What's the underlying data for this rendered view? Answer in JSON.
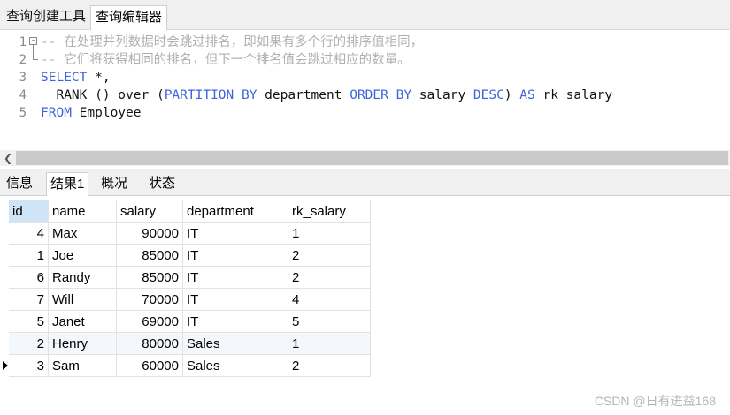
{
  "top_tabs": [
    "查询创建工具",
    "查询编辑器"
  ],
  "editor": {
    "line_numbers": [
      "1",
      "2",
      "3",
      "4",
      "5"
    ],
    "lines": [
      [
        {
          "t": "cm",
          "v": "-- 在处理并列数据时会跳过排名，即如果有多个行的排序值相同，"
        }
      ],
      [
        {
          "t": "cm",
          "v": "-- 它们将获得相同的排名，但下一个排名值会跳过相应的数量。"
        }
      ],
      [
        {
          "t": "kw",
          "v": "SELECT"
        },
        {
          "t": "pl",
          "v": " *,"
        }
      ],
      [
        {
          "t": "pl",
          "v": "  RANK () over ("
        },
        {
          "t": "kw",
          "v": "PARTITION BY"
        },
        {
          "t": "pl",
          "v": " department "
        },
        {
          "t": "kw",
          "v": "ORDER BY"
        },
        {
          "t": "pl",
          "v": " salary "
        },
        {
          "t": "kw",
          "v": "DESC"
        },
        {
          "t": "pl",
          "v": ") "
        },
        {
          "t": "kw",
          "v": "AS"
        },
        {
          "t": "pl",
          "v": " rk_salary"
        }
      ],
      [
        {
          "t": "kw",
          "v": "FROM"
        },
        {
          "t": "pl",
          "v": " Employee"
        }
      ]
    ]
  },
  "result_tabs": [
    "信息",
    "结果1",
    "概况",
    "状态"
  ],
  "active_result_tab": 1,
  "grid": {
    "columns": [
      "id",
      "name",
      "salary",
      "department",
      "rk_salary"
    ],
    "rows": [
      [
        "4",
        "Max",
        "90000",
        "IT",
        "1"
      ],
      [
        "1",
        "Joe",
        "85000",
        "IT",
        "2"
      ],
      [
        "6",
        "Randy",
        "85000",
        "IT",
        "2"
      ],
      [
        "7",
        "Will",
        "70000",
        "IT",
        "4"
      ],
      [
        "5",
        "Janet",
        "69000",
        "IT",
        "5"
      ],
      [
        "2",
        "Henry",
        "80000",
        "Sales",
        "1"
      ],
      [
        "3",
        "Sam",
        "60000",
        "Sales",
        "2"
      ]
    ],
    "current_row": 6
  },
  "watermark": "CSDN @日有进益168"
}
